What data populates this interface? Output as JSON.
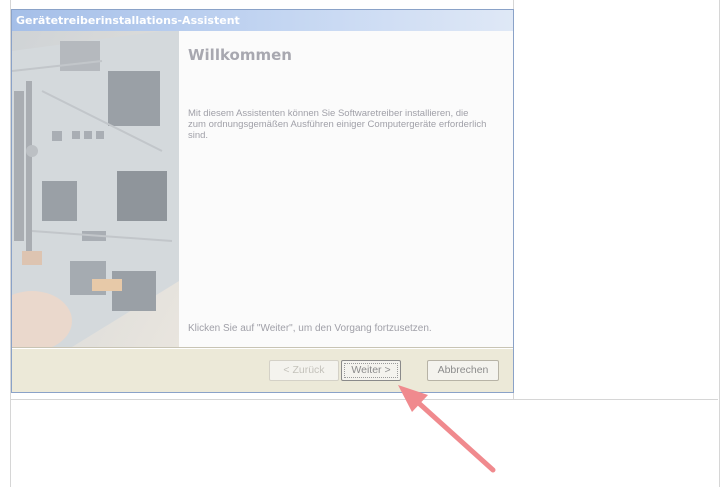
{
  "dialog": {
    "title": "Gerätetreiberinstallations-Assistent",
    "heading": "Willkommen",
    "intro_text": "Mit diesem Assistenten können Sie Softwaretreiber installieren, die zum ordnungsgemäßen Ausführen einiger Computergeräte erforderlich sind.",
    "continue_hint": "Klicken Sie auf \"Weiter\", um den Vorgang fortzusetzen.",
    "buttons": {
      "back": "< Zurück",
      "next": "Weiter >",
      "cancel": "Abbrechen"
    }
  },
  "colors": {
    "annotation_arrow": "#f08a8e"
  }
}
